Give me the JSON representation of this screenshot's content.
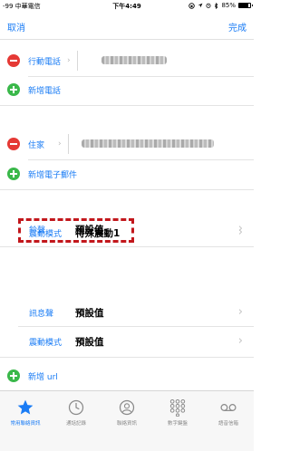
{
  "status_bar": {
    "carrier": "-99 中華電信",
    "time": "下午4:49",
    "battery_text": "85%",
    "battery_level": 0.85
  },
  "nav": {
    "cancel": "取消",
    "done": "完成"
  },
  "phone": {
    "label": "行動電話",
    "add_label": "新增電話"
  },
  "email": {
    "label": "住家",
    "add_label": "新增電子郵件"
  },
  "ringtone": {
    "label": "鈴聲",
    "value": "預設值"
  },
  "vibration": {
    "label": "震動模式",
    "value": "特殊震動1"
  },
  "text_tone": {
    "label": "訊息聲",
    "value": "預設值"
  },
  "text_vibration": {
    "label": "震動模式",
    "value": "預設值"
  },
  "url": {
    "add_label": "新增 url"
  },
  "tabbar": {
    "tabs": [
      {
        "label": "常用聯絡資訊",
        "icon": "star-icon"
      },
      {
        "label": "通話記錄",
        "icon": "clock-icon"
      },
      {
        "label": "聯絡資訊",
        "icon": "contacts-icon"
      },
      {
        "label": "數字鍵盤",
        "icon": "keypad-icon"
      },
      {
        "label": "語音信箱",
        "icon": "voicemail-icon"
      }
    ]
  },
  "colors": {
    "accent": "#1a7cf5",
    "delete": "#e53935",
    "add": "#3ab84a",
    "highlight": "#c2171c"
  }
}
